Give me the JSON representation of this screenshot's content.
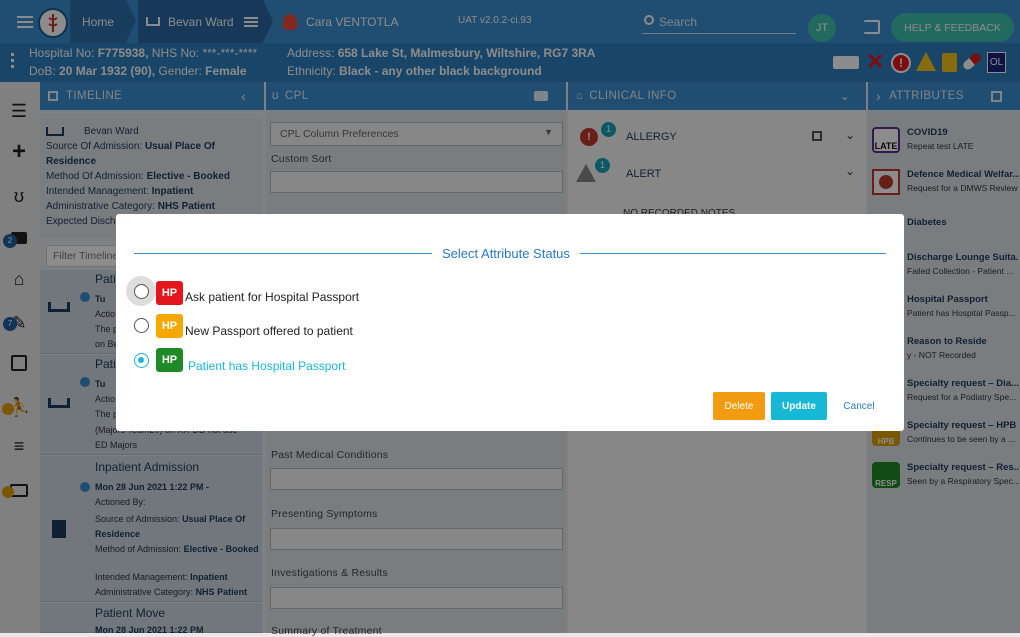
{
  "colors": {
    "header": "#3b8ed0",
    "info_bar": "#2f7fc0",
    "accent": "#17b8d6",
    "delete": "#f39c12",
    "hp_red": "#e3171b",
    "hp_amber": "#f5a800",
    "hp_green": "#1e8b26"
  },
  "topbar": {
    "home_label": "Home",
    "ward_label": "Bevan Ward",
    "patient_name": "Cara VENTOTLA",
    "env_badge": "UAT v2.0.2-ci.93",
    "search_placeholder": "Search",
    "user_initials": "JT",
    "help_label": "HELP & FEEDBACK"
  },
  "patient": {
    "hospital_no_label": "Hospital No:",
    "hospital_no": "F775938,",
    "nhs_no_label": "NHS No:",
    "nhs_no": "***-***-****",
    "dob_label": "DoB:",
    "dob": "20 Mar 1932 (90),",
    "gender_label": "Gender:",
    "gender": "Female",
    "address_label": "Address:",
    "address": "658 Lake St, Malmesbury, Wiltshire, RG7 3RA",
    "ethnicity_label": "Ethnicity:",
    "ethnicity": "Black - any other black background",
    "ol_badge": "OL"
  },
  "sidebar_badges": {
    "camera": "2",
    "edit": "7"
  },
  "panels": {
    "timeline": "TIMELINE",
    "cpl": "CPL",
    "clinical": "CLINICAL INFO",
    "attributes": "ATTRIBUTES"
  },
  "timeline": {
    "ward": "Bevan Ward",
    "source_label": "Source Of Admission:",
    "source": "Usual Place Of Residence",
    "method_label": "Method Of Admission:",
    "method": "Elective - Booked",
    "intended_label": "Intended Management:",
    "intended": "Inpatient",
    "admin_label": "Administrative Category:",
    "admin": "NHS Patient",
    "expected": "Expected Disch",
    "filter_placeholder": "Filter Timeline",
    "item1_title": "Pati",
    "item1_date": "Tu",
    "item1_a": "Actio",
    "item1_b": "The p",
    "item1_c": "on Be",
    "item2_title": "Pati",
    "item2_date": "Tu",
    "item2_a": "Actio",
    "item2_b": "The p",
    "item2_c": "(Majors Team20) on XX-DD not use -",
    "item2_d": "ED Majors",
    "item3_title": "Inpatient Admission",
    "item3_date": "Mon 28 Jun 2021 1:22 PM -",
    "item3_actioned": "Actioned By:",
    "item3_source_label": "Source of Admission:",
    "item3_source": "Usual Place Of Residence",
    "item3_method_label": "Method of Admission:",
    "item3_method": "Elective - Booked",
    "item3_intended_label": "Intended Management:",
    "item3_intended": "Inpatient",
    "item3_admin_label": "Administrative Category:",
    "item3_admin": "NHS Patient",
    "item4_title": "Patient Move",
    "item4_date": "Mon 28 Jun 2021 1:22 PM"
  },
  "cpl": {
    "column_prefs": "CPL Column Preferences",
    "custom_sort": "Custom Sort",
    "past_medical": "Past Medical Conditions",
    "presenting": "Presenting Symptoms",
    "investigations": "Investigations & Results",
    "summary": "Summary of Treatment"
  },
  "clinical": {
    "allergy_label": "ALLERGY",
    "allergy_count": "1",
    "alert_label": "ALERT",
    "alert_count": "1",
    "no_notes": "NO RECORDED NOTES"
  },
  "attributes": [
    {
      "title": "COVID19",
      "sub": "Repeat test LATE",
      "icon": "covid-late-icon",
      "badge": "LATE"
    },
    {
      "title": "Defence Medical Welfar...",
      "sub": "Request for a DMWS Review",
      "icon": "poppy-icon",
      "badge": ""
    },
    {
      "title": "Diabetes",
      "sub": "",
      "icon": "",
      "badge": ""
    },
    {
      "title": "Discharge Lounge Suita...",
      "sub": "Failed Collection - Patient ...",
      "icon": "",
      "badge": ""
    },
    {
      "title": "Hospital Passport",
      "sub": "Patient has Hospital Passp...",
      "icon": "",
      "badge": ""
    },
    {
      "title": "Reason to Reside",
      "sub": "y - NOT Recorded",
      "icon": "",
      "badge": ""
    },
    {
      "title": "Specialty request – Dia...",
      "sub": "Request for a Podiatry Spe...",
      "icon": "",
      "badge": ""
    },
    {
      "title": "Specialty request – HPB",
      "sub": "Continues to be seen by a ...",
      "icon": "hpb-icon",
      "badge": "HPB"
    },
    {
      "title": "Specialty request – Res...",
      "sub": "Seen by a Respiratory Spec...",
      "icon": "resp-icon",
      "badge": "RESP"
    }
  ],
  "modal": {
    "title": "Select Attribute Status",
    "hp_text": "HP",
    "option1": "Ask patient for Hospital Passport",
    "option2": "New Passport offered to patient",
    "option3": "Patient has Hospital Passport",
    "selected": "option3",
    "delete": "Delete",
    "update": "Update",
    "cancel": "Cancel"
  }
}
